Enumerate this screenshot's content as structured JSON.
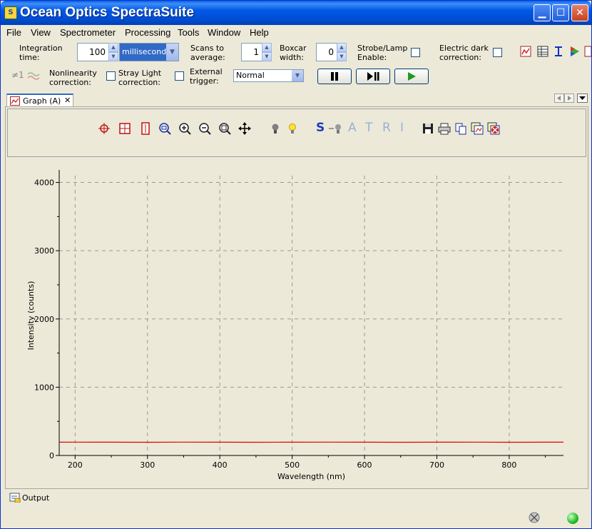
{
  "window": {
    "title": "Ocean Optics SpectraSuite",
    "app_icon_text": "S"
  },
  "menu": [
    "File",
    "View",
    "Spectrometer",
    "Processing",
    "Tools",
    "Window",
    "Help"
  ],
  "acquisition": {
    "integration_label_1": "Integration",
    "integration_label_2": "time:",
    "integration_value": "100",
    "integration_units": "milliseconds",
    "scans_label_1": "Scans to",
    "scans_label_2": "average:",
    "scans_value": "1",
    "boxcar_label_1": "Boxcar",
    "boxcar_label_2": "width:",
    "boxcar_value": "0",
    "strobe_label_1": "Strobe/Lamp",
    "strobe_label_2": "Enable:",
    "dark_label_1": "Electric dark",
    "dark_label_2": "correction:",
    "nonlin_label_1": "Nonlinearity",
    "nonlin_label_2": "correction:",
    "stray_label_1": "Stray Light",
    "stray_label_2": "correction:",
    "trigger_label_1": "External",
    "trigger_label_2": "trigger:",
    "trigger_value": "Normal",
    "nonlin_glyph": "≠1"
  },
  "tab": {
    "label": "Graph (A)",
    "close": "✕"
  },
  "graph_letters": [
    "S",
    "A",
    "T",
    "R",
    "I"
  ],
  "output_label": "Output",
  "colors": {
    "trace": "#E00000",
    "grid": "#999999"
  },
  "chart_data": {
    "type": "line",
    "xlabel": "Wavelength (nm)",
    "ylabel": "Intensity (counts)",
    "xlim": [
      178,
      875
    ],
    "ylim": [
      0,
      4100
    ],
    "x_ticks": [
      200,
      300,
      400,
      500,
      600,
      700,
      800
    ],
    "y_ticks": [
      0,
      1000,
      2000,
      3000,
      4000
    ],
    "grid": true,
    "series": [
      {
        "x": [
          178,
          200,
          250,
          300,
          350,
          400,
          450,
          500,
          550,
          600,
          650,
          700,
          750,
          800,
          850,
          875
        ],
        "values": [
          195,
          196,
          195,
          194,
          196,
          195,
          194,
          195,
          196,
          195,
          194,
          195,
          196,
          194,
          195,
          195
        ]
      }
    ]
  }
}
